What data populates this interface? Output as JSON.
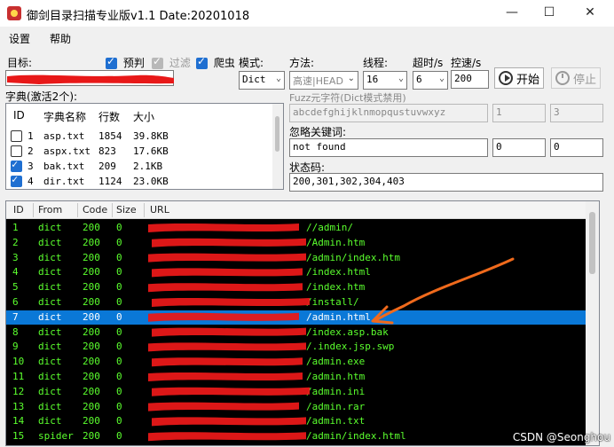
{
  "window": {
    "title": "御剑目录扫描专业版v1.1 Date:20201018",
    "min_glyph": "—",
    "max_glyph": "☐",
    "close_glyph": "✕"
  },
  "menu": {
    "items": [
      "设置",
      "帮助"
    ]
  },
  "controls": {
    "target_label": "目标:",
    "target_value": "",
    "checkbox_prejudge": "预判",
    "checkbox_filter": "过滤",
    "checkbox_crawler": "爬虫",
    "mode_label": "模式:",
    "mode_value": "Dict",
    "method_label": "方法:",
    "method_value": "高速|HEAD",
    "threads_label": "线程:",
    "threads_value": "16",
    "timeout_label": "超时/s",
    "timeout_value": "6",
    "rate_label": "控速/s",
    "rate_value": "200",
    "start_button": "开始",
    "stop_button": "停止"
  },
  "dict": {
    "section_label": "字典(激活2个):",
    "headers": [
      "ID",
      "字典名称",
      "行数",
      "大小"
    ],
    "rows": [
      {
        "id": "1",
        "name": "asp.txt",
        "lines": "1854",
        "size": "39.8KB",
        "checked": false
      },
      {
        "id": "2",
        "name": "aspx.txt",
        "lines": "823",
        "size": "17.6KB",
        "checked": false
      },
      {
        "id": "3",
        "name": "bak.txt",
        "lines": "209",
        "size": "2.1KB",
        "checked": true
      },
      {
        "id": "4",
        "name": "dir.txt",
        "lines": "1124",
        "size": "23.0KB",
        "checked": true
      }
    ]
  },
  "fuzz": {
    "placeholder_label": "Fuzz元字符(Dict模式禁用)",
    "charset": "abcdefghijklnmopqustuvwxyz",
    "min": "1",
    "max": "3"
  },
  "ignore": {
    "label": "忽略关键词:",
    "value": "not found",
    "a": "0",
    "b": "0"
  },
  "status": {
    "label": "状态码:",
    "value": "200,301,302,304,403"
  },
  "results": {
    "headers": [
      "ID",
      "From",
      "Code",
      "Size",
      "URL"
    ],
    "selected_index": 6,
    "rows": [
      {
        "id": "1",
        "from": "dict",
        "code": "200",
        "size": "0",
        "url": "//admin/"
      },
      {
        "id": "2",
        "from": "dict",
        "code": "200",
        "size": "0",
        "url": "/Admin.htm"
      },
      {
        "id": "3",
        "from": "dict",
        "code": "200",
        "size": "0",
        "url": "/admin/index.htm"
      },
      {
        "id": "4",
        "from": "dict",
        "code": "200",
        "size": "0",
        "url": "/index.html"
      },
      {
        "id": "5",
        "from": "dict",
        "code": "200",
        "size": "0",
        "url": "/index.htm"
      },
      {
        "id": "6",
        "from": "dict",
        "code": "200",
        "size": "0",
        "url": "/install/"
      },
      {
        "id": "7",
        "from": "dict",
        "code": "200",
        "size": "0",
        "url": "/admin.html"
      },
      {
        "id": "8",
        "from": "dict",
        "code": "200",
        "size": "0",
        "url": "/index.asp.bak"
      },
      {
        "id": "9",
        "from": "dict",
        "code": "200",
        "size": "0",
        "url": "/.index.jsp.swp"
      },
      {
        "id": "10",
        "from": "dict",
        "code": "200",
        "size": "0",
        "url": "/admin.exe"
      },
      {
        "id": "11",
        "from": "dict",
        "code": "200",
        "size": "0",
        "url": "/admin.htm"
      },
      {
        "id": "12",
        "from": "dict",
        "code": "200",
        "size": "0",
        "url": "/admin.ini"
      },
      {
        "id": "13",
        "from": "dict",
        "code": "200",
        "size": "0",
        "url": "/admin.rar"
      },
      {
        "id": "14",
        "from": "dict",
        "code": "200",
        "size": "0",
        "url": "/admin.txt"
      },
      {
        "id": "15",
        "from": "spider",
        "code": "200",
        "size": "0",
        "url": "/admin/index.html"
      }
    ]
  },
  "watermark": "CSDN @Seonghou",
  "colors": {
    "result_text": "#5bff2e",
    "selection": "#0a78d7",
    "redaction": "#e81818",
    "annotation_arrow": "#f06a1c",
    "checkbox": "#1f6fd1"
  }
}
